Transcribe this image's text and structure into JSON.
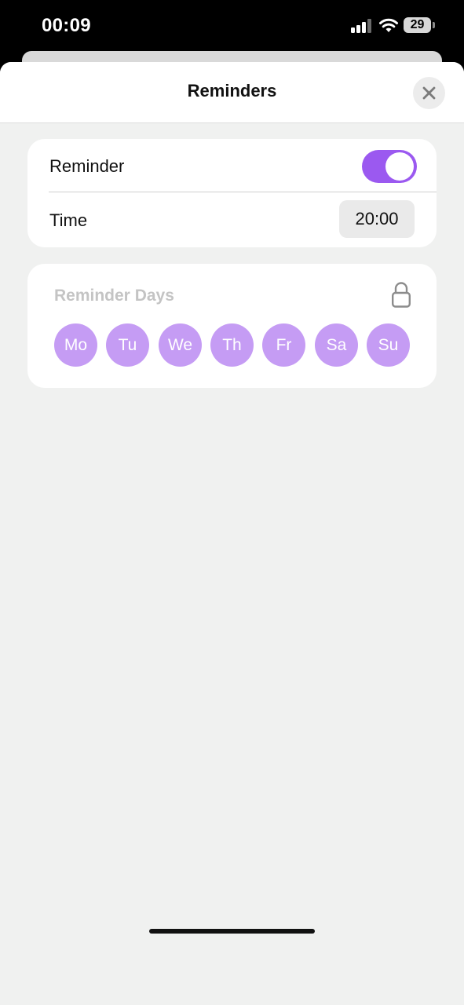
{
  "status_bar": {
    "time": "00:09",
    "battery": "29",
    "icons": [
      "signal-icon",
      "wifi-icon",
      "battery-icon"
    ]
  },
  "sheet": {
    "title": "Reminders",
    "close_icon": "close-icon"
  },
  "reminder": {
    "label": "Reminder",
    "enabled": true,
    "time_label": "Time",
    "time_value": "20:00"
  },
  "days": {
    "title": "Reminder Days",
    "locked": true,
    "lock_icon": "lock-icon",
    "items": [
      "Mo",
      "Tu",
      "We",
      "Th",
      "Fr",
      "Sa",
      "Su"
    ]
  },
  "colors": {
    "accent": "#9b59f0",
    "day_chip": "#c59cf4",
    "background": "#f0f1f0"
  }
}
